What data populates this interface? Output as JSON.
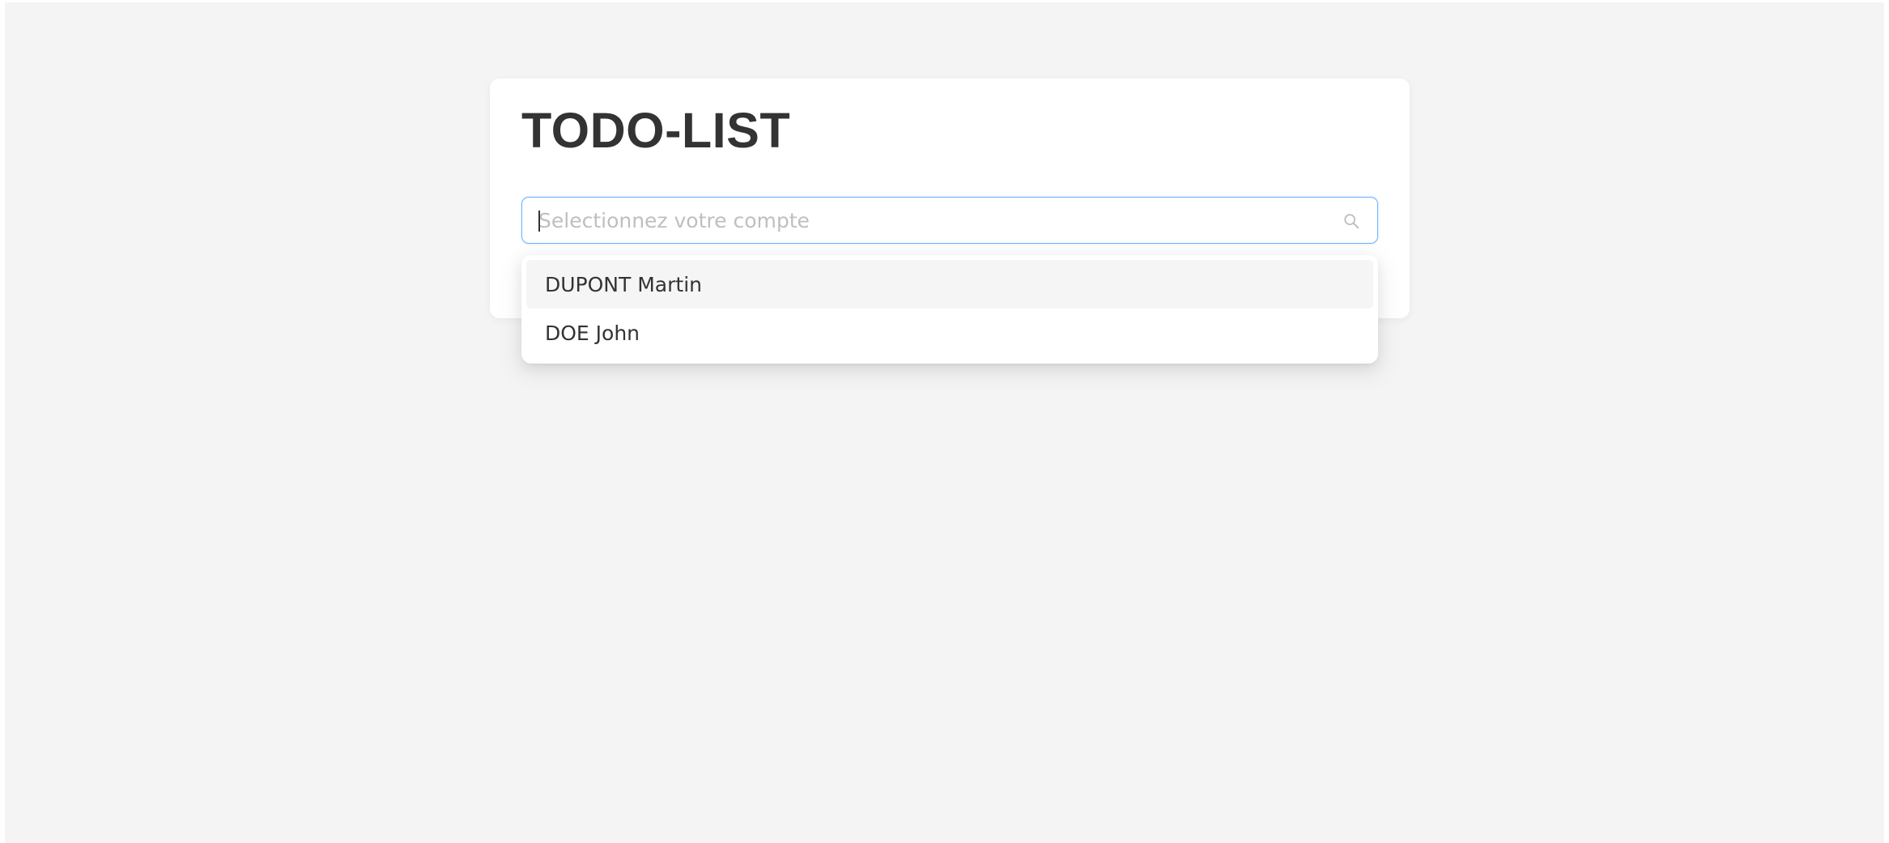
{
  "page": {
    "title": "TODO-LIST"
  },
  "search": {
    "placeholder": "Selectionnez votre compte",
    "icon": "search-icon"
  },
  "dropdown": {
    "options": [
      {
        "label": "DUPONT Martin",
        "active": true
      },
      {
        "label": "DOE John",
        "active": false
      }
    ]
  },
  "colors": {
    "background": "#f4f4f4",
    "card": "#ffffff",
    "focus_border": "#69b1ff",
    "text": "#333333",
    "placeholder": "#bfbfbf",
    "option_hover": "#f5f5f5"
  }
}
